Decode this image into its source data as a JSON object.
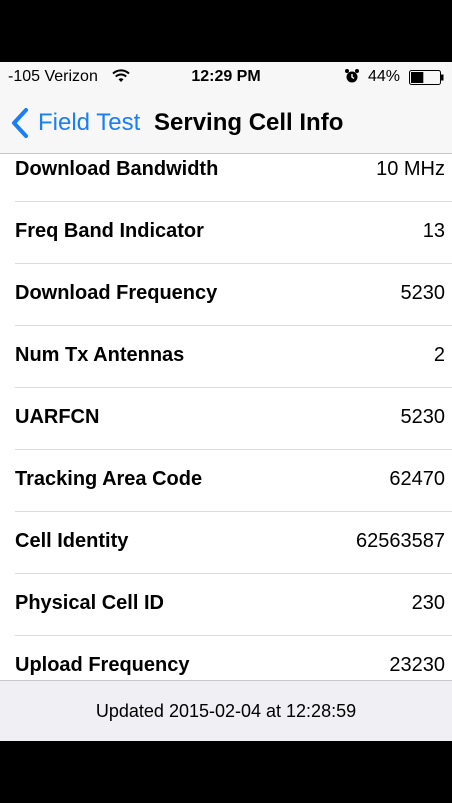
{
  "status_bar": {
    "signal": "-105 Verizon",
    "time": "12:29 PM",
    "battery_percent": "44%",
    "battery_level": 0.44,
    "icons": [
      "wifi-icon",
      "alarm-icon",
      "battery-icon"
    ]
  },
  "nav": {
    "back_label": "Field Test",
    "title": "Serving Cell Info",
    "accent_color": "#1a7ef6"
  },
  "rows": [
    {
      "label": "Download Bandwidth",
      "value": "10 MHz"
    },
    {
      "label": "Freq Band Indicator",
      "value": "13"
    },
    {
      "label": "Download Frequency",
      "value": "5230"
    },
    {
      "label": "Num Tx Antennas",
      "value": "2"
    },
    {
      "label": "UARFCN",
      "value": "5230"
    },
    {
      "label": "Tracking Area Code",
      "value": "62470"
    },
    {
      "label": "Cell Identity",
      "value": "62563587"
    },
    {
      "label": "Physical Cell ID",
      "value": "230"
    },
    {
      "label": "Upload Frequency",
      "value": "23230"
    }
  ],
  "footer": {
    "updated_text": "Updated 2015-02-04 at 12:28:59"
  }
}
